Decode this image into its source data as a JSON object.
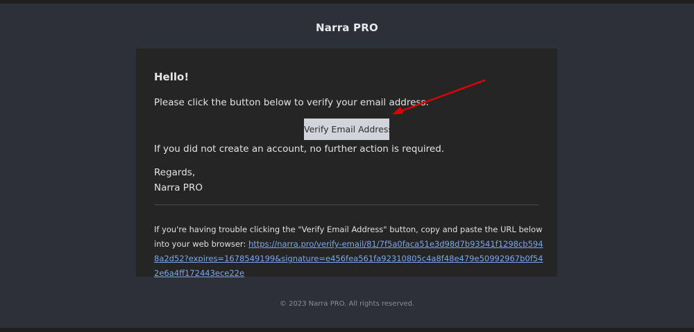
{
  "header": {
    "brand": "Narra PRO"
  },
  "email": {
    "greeting": "Hello!",
    "intro": "Please click the button below to verify your email address.",
    "verify_button_label": "Verify Email Address",
    "no_action": "If you did not create an account, no further action is required.",
    "regards": "Regards,",
    "signoff": "Narra PRO",
    "trouble_text": "If you're having trouble clicking the \"Verify Email Address\" button, copy and paste the URL below into your web browser: ",
    "verify_url": "https://narra.pro/verify-email/81/7f5a0faca51e3d98d7b93541f1298cb5948a2d52?expires=1678549199&signature=e456fea561fa92310805c4a8f48e479e50992967b0f542e6a4ff172443ece22e"
  },
  "footer": {
    "copyright": "© 2023 Narra PRO. All rights reserved."
  },
  "annotation": {
    "arrow_color": "#e00000"
  }
}
